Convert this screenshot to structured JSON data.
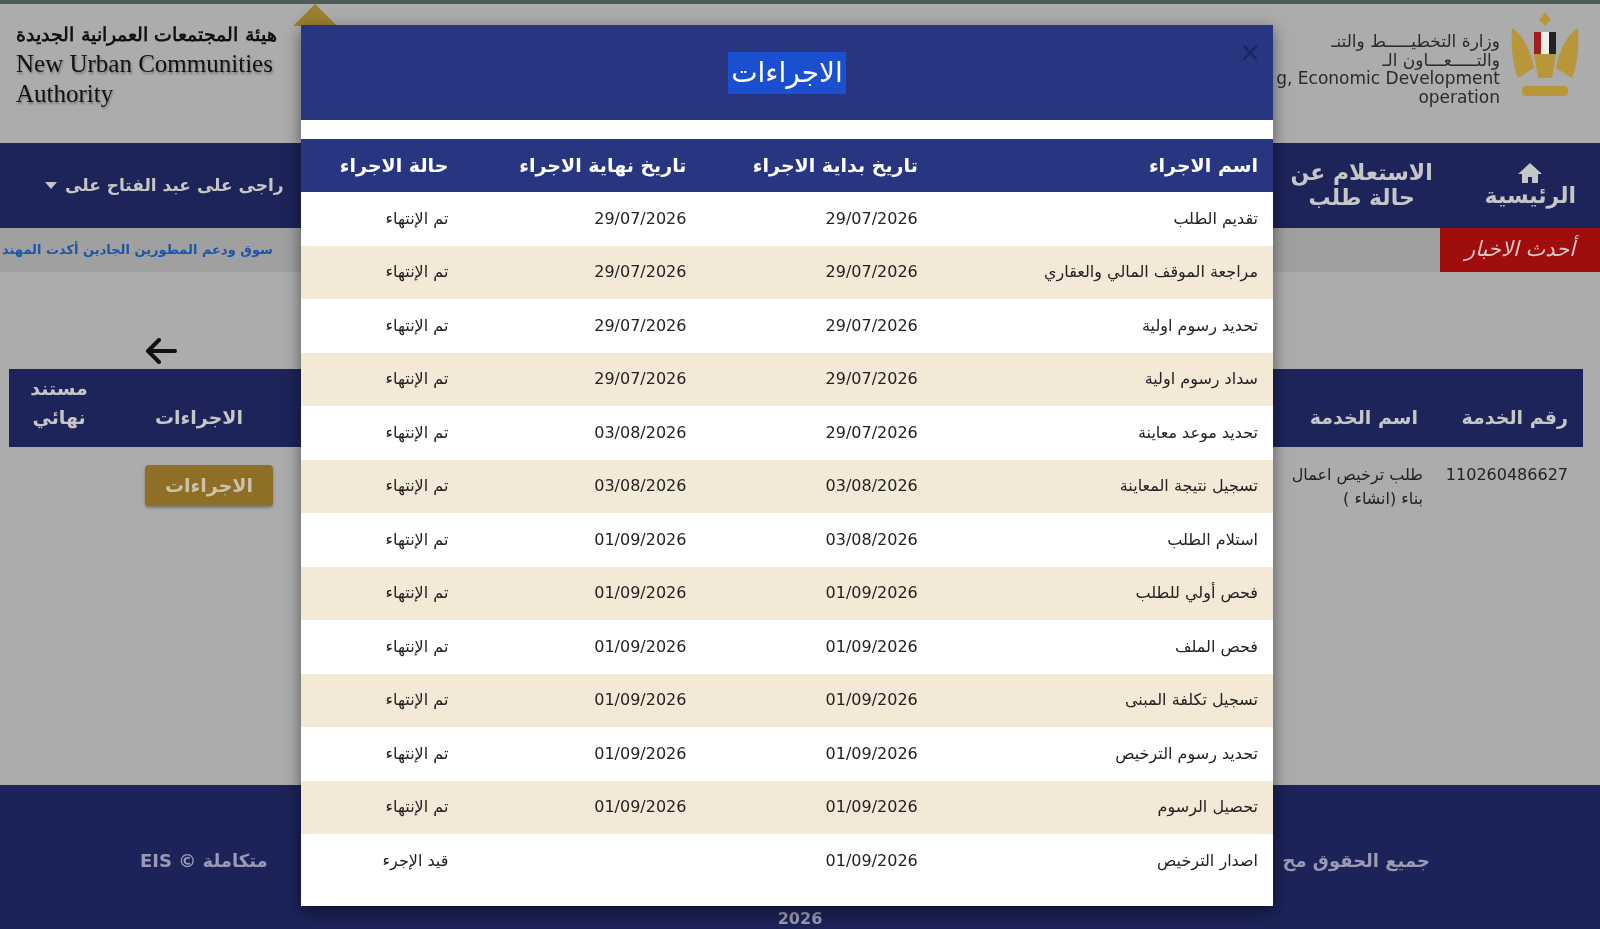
{
  "header": {
    "authority_ar": "هيئة المجتمعات العمرانية الجديدة",
    "authority_en": [
      "New Urban Communities",
      "Authority"
    ],
    "ministry": [
      "وزارة التخطيـــــط والتنـ",
      "والتـــــعـــاون الـ",
      "g, Economic Development",
      "operation"
    ]
  },
  "nav": {
    "items": [
      {
        "label": "الرئيسية",
        "kind": "home"
      },
      {
        "label": "الاستعلام عن حالة طلب",
        "kind": "text"
      }
    ],
    "user": "راجى على عبد الفتاح على"
  },
  "news": {
    "label": "أحدث الاخبار",
    "ticker": "سوق ودعم المطورين الجادين أكدت المهند"
  },
  "requests_table": {
    "right_columns": [
      "رقم الخدمة",
      "اسم الخدمة"
    ],
    "left_columns": [
      "الاجراءات",
      "مستند نهائي"
    ],
    "rows": [
      {
        "service_number": "110260486627",
        "service_name": "طلب ترخيص اعمال بناء (انشاء )",
        "action_button": "الاجراءات"
      }
    ]
  },
  "footer": {
    "rights": "جميع الحقوق مح",
    "platform": "متكاملة © EIS",
    "year": "2026"
  },
  "modal": {
    "title": "الاجراءات",
    "close": "×",
    "columns": [
      "اسم الاجراء",
      "تاريخ بداية الاجراء",
      "تاريخ نهاية الاجراء",
      "حالة الاجراء"
    ],
    "rows": [
      {
        "name": "تقديم الطلب",
        "start": "29/07/2026",
        "end": "29/07/2026",
        "status": "تم الإنتهاء"
      },
      {
        "name": "مراجعة الموقف المالي والعقاري",
        "start": "29/07/2026",
        "end": "29/07/2026",
        "status": "تم الإنتهاء"
      },
      {
        "name": "تحديد رسوم اولية",
        "start": "29/07/2026",
        "end": "29/07/2026",
        "status": "تم الإنتهاء"
      },
      {
        "name": "سداد رسوم اولية",
        "start": "29/07/2026",
        "end": "29/07/2026",
        "status": "تم الإنتهاء"
      },
      {
        "name": "تحديد موعد معاينة",
        "start": "29/07/2026",
        "end": "03/08/2026",
        "status": "تم الإنتهاء"
      },
      {
        "name": "تسجيل نتيجة المعاينة",
        "start": "03/08/2026",
        "end": "03/08/2026",
        "status": "تم الإنتهاء"
      },
      {
        "name": "استلام الطلب",
        "start": "03/08/2026",
        "end": "01/09/2026",
        "status": "تم الإنتهاء"
      },
      {
        "name": "فحص أولي للطلب",
        "start": "01/09/2026",
        "end": "01/09/2026",
        "status": "تم الإنتهاء"
      },
      {
        "name": "فحص الملف",
        "start": "01/09/2026",
        "end": "01/09/2026",
        "status": "تم الإنتهاء"
      },
      {
        "name": "تسجيل تكلفة المبنى",
        "start": "01/09/2026",
        "end": "01/09/2026",
        "status": "تم الإنتهاء"
      },
      {
        "name": "تحديد رسوم الترخيص",
        "start": "01/09/2026",
        "end": "01/09/2026",
        "status": "تم الإنتهاء"
      },
      {
        "name": "تحصيل الرسوم",
        "start": "01/09/2026",
        "end": "01/09/2026",
        "status": "تم الإنتهاء"
      },
      {
        "name": "اصدار الترخيص",
        "start": "01/09/2026",
        "status": "قيد الإجرء"
      }
    ]
  }
}
